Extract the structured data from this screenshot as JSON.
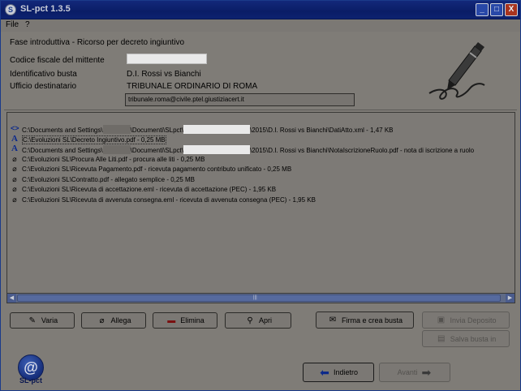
{
  "window": {
    "title": "SL-pct 1.3.5",
    "controls": {
      "minimize": "_",
      "maximize": "□",
      "close": "X"
    }
  },
  "menu": {
    "items": [
      "File",
      "?"
    ]
  },
  "header": {
    "title": "Fase introduttiva - Ricorso per decreto ingiuntivo",
    "fields": [
      {
        "label": "Codice fiscale del mittente",
        "value": ""
      },
      {
        "label": "Identificativo busta",
        "value": "D.I. Rossi vs Bianchi"
      },
      {
        "label": "Ufficio destinatario",
        "value": "TRIBUNALE ORDINARIO DI ROMA"
      }
    ],
    "pec_address": "tribunale.roma@civile.ptel.giustiziacert.it"
  },
  "files": [
    {
      "icon": "xml-icon",
      "glyph": "<>",
      "before": "C:\\Documents and Settings\\",
      "middle": "\\Documenti\\SLpct\\",
      "after": "\\2015\\D.I. Rossi vs Bianchi\\DatiAtto.xml - 1,47 KB",
      "masked": true,
      "selected": false
    },
    {
      "icon": "pdf-icon",
      "glyph": "A",
      "text": "C:\\Evoluzioni SL\\Decreto Ingiuntivo.pdf - 0,25 MB",
      "masked": false,
      "selected": true
    },
    {
      "icon": "pdf-icon",
      "glyph": "A",
      "before": "C:\\Documents and Settings\\",
      "middle": "\\Documenti\\SLpct\\",
      "after": "\\2015\\D.I. Rossi vs Bianchi\\NotaIscrizioneRuolo.pdf - nota di iscrizione a ruolo",
      "masked": true,
      "selected": false
    },
    {
      "icon": "paperclip-icon",
      "glyph": "⌀",
      "text": "C:\\Evoluzioni SL\\Procura Alle Liti.pdf - procura alle liti - 0,25 MB",
      "masked": false,
      "selected": false
    },
    {
      "icon": "paperclip-icon",
      "glyph": "⌀",
      "text": "C:\\Evoluzioni SL\\Ricevuta Pagamento.pdf - ricevuta pagamento contributo unificato - 0,25 MB",
      "masked": false,
      "selected": false
    },
    {
      "icon": "paperclip-icon",
      "glyph": "⌀",
      "text": "C:\\Evoluzioni SL\\Contratto.pdf - allegato semplice - 0,25 MB",
      "masked": false,
      "selected": false
    },
    {
      "icon": "paperclip-icon",
      "glyph": "⌀",
      "text": "C:\\Evoluzioni SL\\Ricevuta di accettazione.eml - ricevuta di accettazione (PEC) - 1,95 KB",
      "masked": false,
      "selected": false
    },
    {
      "icon": "paperclip-icon",
      "glyph": "⌀",
      "text": "C:\\Evoluzioni SL\\Ricevuta di avvenuta consegna.eml - ricevuta di avvenuta consegna (PEC) - 1,95 KB",
      "masked": false,
      "selected": false
    }
  ],
  "buttons": {
    "varia": "Varia",
    "allega": "Allega",
    "elimina": "Elimina",
    "apri": "Apri",
    "firma": "Firma e crea busta",
    "invia": "Invia Deposito",
    "salva": "Salva busta in",
    "indietro": "Indietro",
    "avanti": "Avanti"
  },
  "logo": {
    "symbol": "@",
    "label": "SL-pct"
  }
}
